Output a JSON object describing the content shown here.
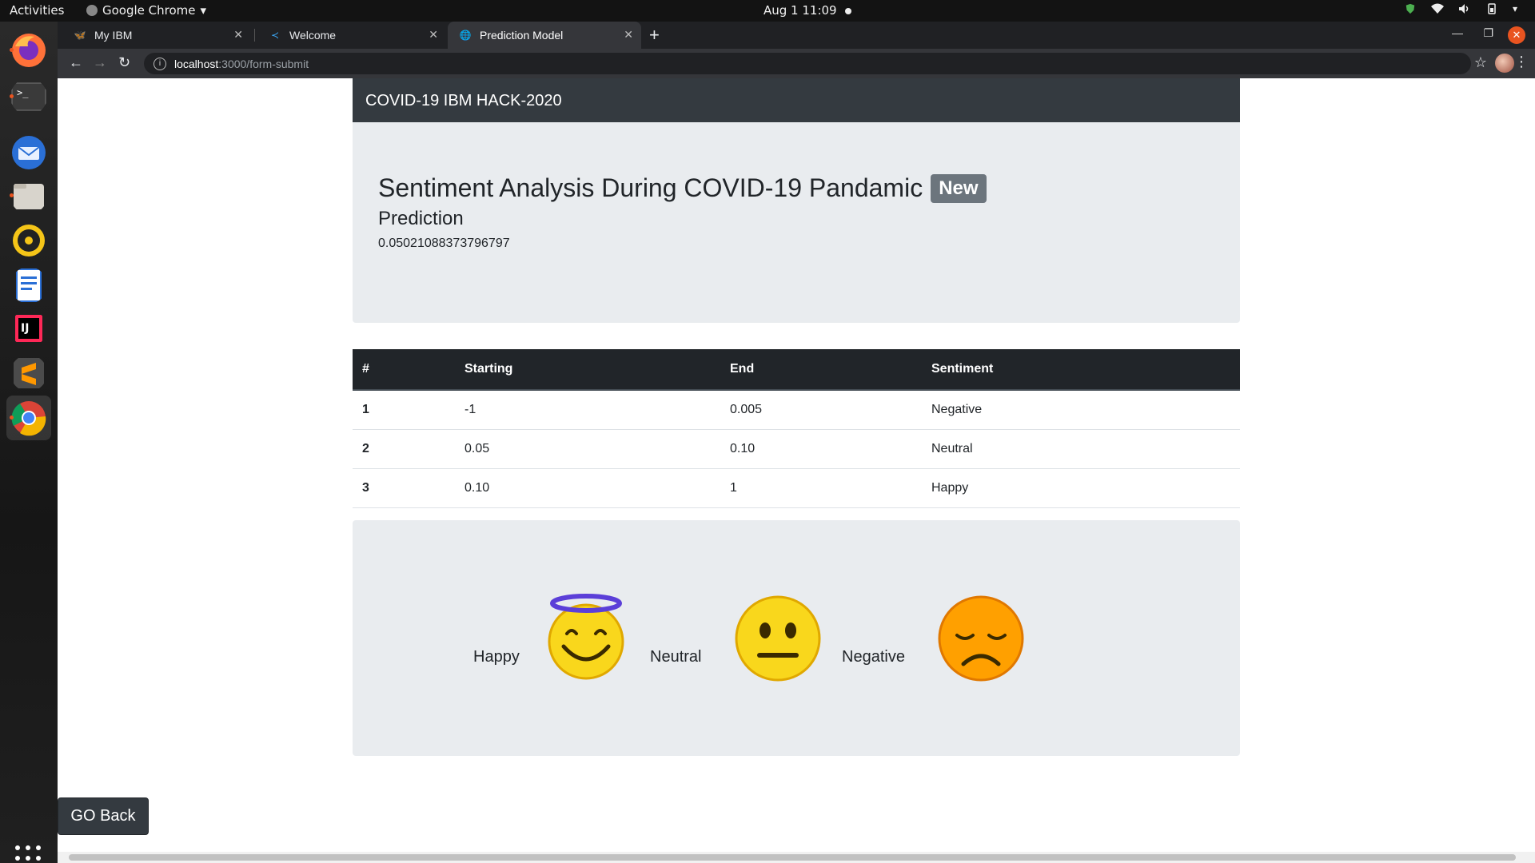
{
  "topbar": {
    "activities": "Activities",
    "app_name": "Google Chrome",
    "clock": "Aug 1  11:09"
  },
  "dock": {
    "items": [
      "firefox-icon",
      "terminal-icon",
      "thunderbird-icon",
      "files-icon",
      "rhythmbox-icon",
      "writer-icon",
      "intellij-icon",
      "sublime-icon",
      "chrome-icon"
    ]
  },
  "browser": {
    "tabs": [
      {
        "label": "My IBM"
      },
      {
        "label": "Welcome"
      },
      {
        "label": "Prediction Model"
      }
    ],
    "url_host": "localhost",
    "url_path": ":3000/form-submit"
  },
  "page": {
    "navbar_title": "COVID-19 IBM HACK-2020",
    "heading": "Sentiment Analysis During COVID-19 Pandamic",
    "badge": "New",
    "subheading": "Prediction",
    "prediction_value": "0.05021088373796797",
    "table": {
      "headers": [
        "#",
        "Starting",
        "End",
        "Sentiment"
      ],
      "rows": [
        [
          "1",
          "-1",
          "0.005",
          "Negative"
        ],
        [
          "2",
          "0.05",
          "0.10",
          "Neutral"
        ],
        [
          "3",
          "0.10",
          "1",
          "Happy"
        ]
      ]
    },
    "emojis": {
      "happy_label": "Happy",
      "neutral_label": "Neutral",
      "negative_label": "Negative"
    },
    "go_back_label": "GO Back"
  },
  "colors": {
    "navbar": "#343a40",
    "jumbotron": "#e9ecef",
    "table_header": "#212529",
    "badge": "#6c757d",
    "ubuntu_accent": "#e95420"
  }
}
